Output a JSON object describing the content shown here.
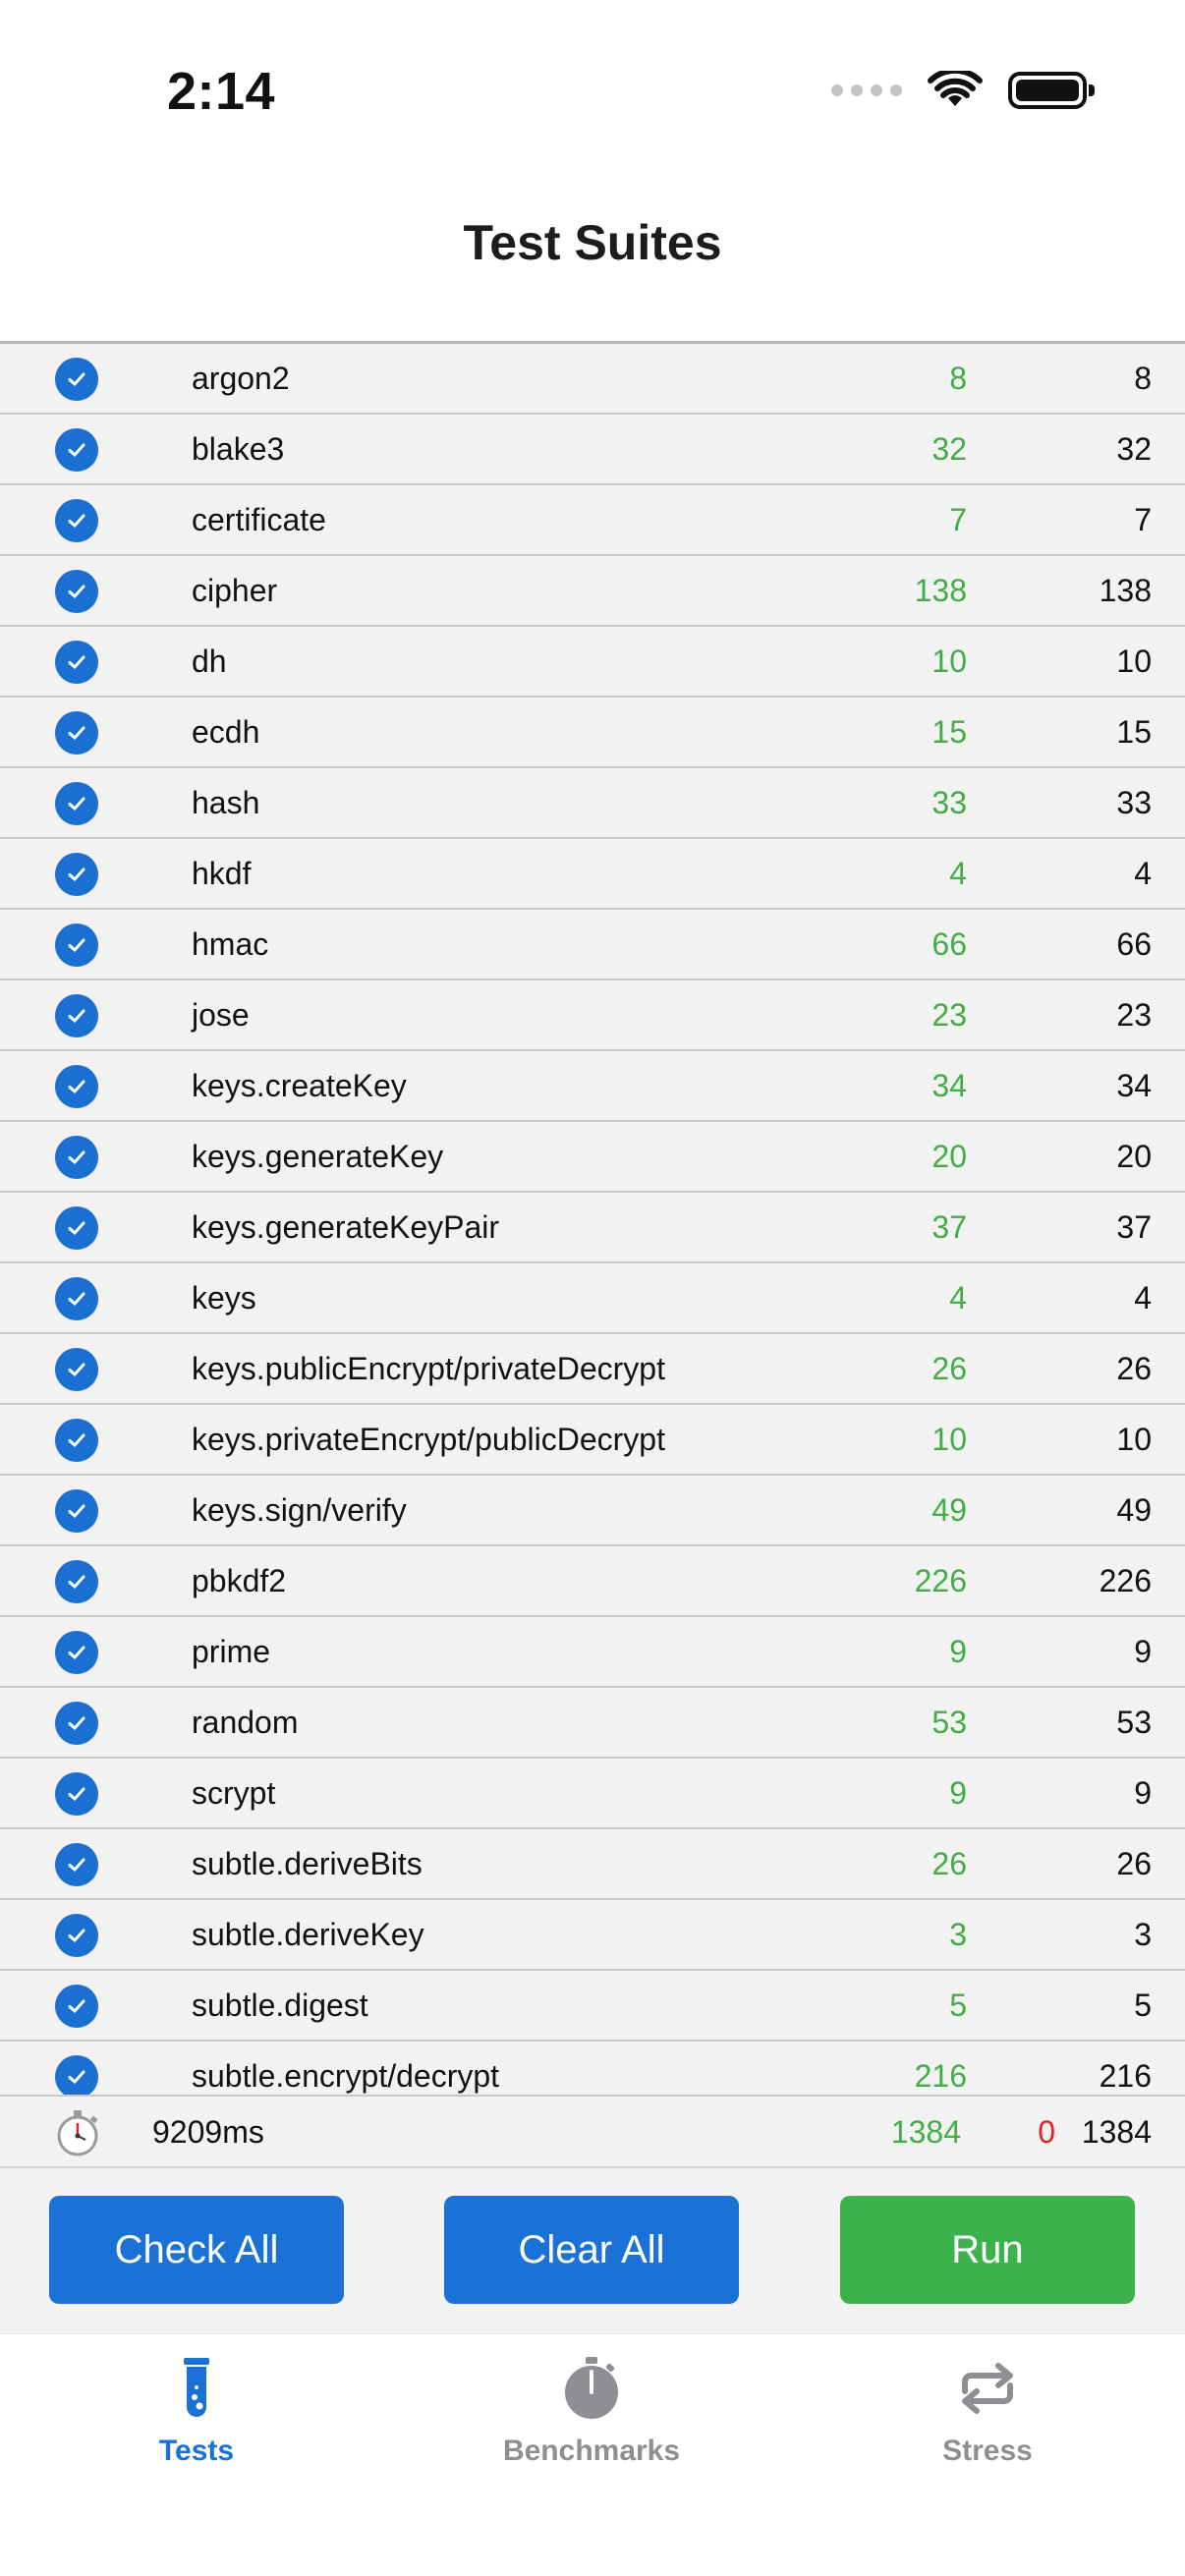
{
  "status_bar": {
    "time": "2:14"
  },
  "header": {
    "title": "Test Suites"
  },
  "suites": [
    {
      "name": "argon2",
      "passed": "8",
      "total": "8"
    },
    {
      "name": "blake3",
      "passed": "32",
      "total": "32"
    },
    {
      "name": "certificate",
      "passed": "7",
      "total": "7"
    },
    {
      "name": "cipher",
      "passed": "138",
      "total": "138"
    },
    {
      "name": "dh",
      "passed": "10",
      "total": "10"
    },
    {
      "name": "ecdh",
      "passed": "15",
      "total": "15"
    },
    {
      "name": "hash",
      "passed": "33",
      "total": "33"
    },
    {
      "name": "hkdf",
      "passed": "4",
      "total": "4"
    },
    {
      "name": "hmac",
      "passed": "66",
      "total": "66"
    },
    {
      "name": "jose",
      "passed": "23",
      "total": "23"
    },
    {
      "name": "keys.createKey",
      "passed": "34",
      "total": "34"
    },
    {
      "name": "keys.generateKey",
      "passed": "20",
      "total": "20"
    },
    {
      "name": "keys.generateKeyPair",
      "passed": "37",
      "total": "37"
    },
    {
      "name": "keys",
      "passed": "4",
      "total": "4"
    },
    {
      "name": "keys.publicEncrypt/privateDecrypt",
      "passed": "26",
      "total": "26"
    },
    {
      "name": "keys.privateEncrypt/publicDecrypt",
      "passed": "10",
      "total": "10"
    },
    {
      "name": "keys.sign/verify",
      "passed": "49",
      "total": "49"
    },
    {
      "name": "pbkdf2",
      "passed": "226",
      "total": "226"
    },
    {
      "name": "prime",
      "passed": "9",
      "total": "9"
    },
    {
      "name": "random",
      "passed": "53",
      "total": "53"
    },
    {
      "name": "scrypt",
      "passed": "9",
      "total": "9"
    },
    {
      "name": "subtle.deriveBits",
      "passed": "26",
      "total": "26"
    },
    {
      "name": "subtle.deriveKey",
      "passed": "3",
      "total": "3"
    },
    {
      "name": "subtle.digest",
      "passed": "5",
      "total": "5"
    },
    {
      "name": "subtle.encrypt/decrypt",
      "passed": "216",
      "total": "216"
    }
  ],
  "summary": {
    "time": "9209ms",
    "passed": "1384",
    "failed": "0",
    "total": "1384"
  },
  "buttons": {
    "check_all": "Check All",
    "clear_all": "Clear All",
    "run": "Run"
  },
  "tabs": [
    {
      "label": "Tests",
      "icon": "test-tube-icon",
      "active": true
    },
    {
      "label": "Benchmarks",
      "icon": "stopwatch-icon",
      "active": false
    },
    {
      "label": "Stress",
      "icon": "repeat-icon",
      "active": false
    }
  ],
  "colors": {
    "accent": "#1b72d6",
    "pass": "#3fae44",
    "fail": "#e0231e",
    "run": "#3bb34a"
  }
}
